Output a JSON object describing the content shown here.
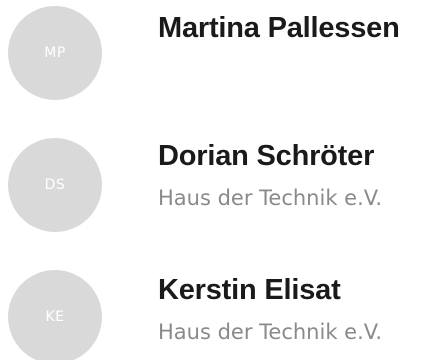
{
  "contacts": [
    {
      "initials": "MP",
      "name": "Martina Pallessen",
      "organization": ""
    },
    {
      "initials": "DS",
      "name": "Dorian Schröter",
      "organization": "Haus der Technik e.V."
    },
    {
      "initials": "KE",
      "name": "Kerstin Elisat",
      "organization": "Haus der Technik e.V."
    }
  ],
  "colors": {
    "avatar_background": "#d9d9d9",
    "avatar_text": "#ffffff",
    "name_text": "#1a1a1a",
    "organization_text": "#8a8a8a"
  }
}
